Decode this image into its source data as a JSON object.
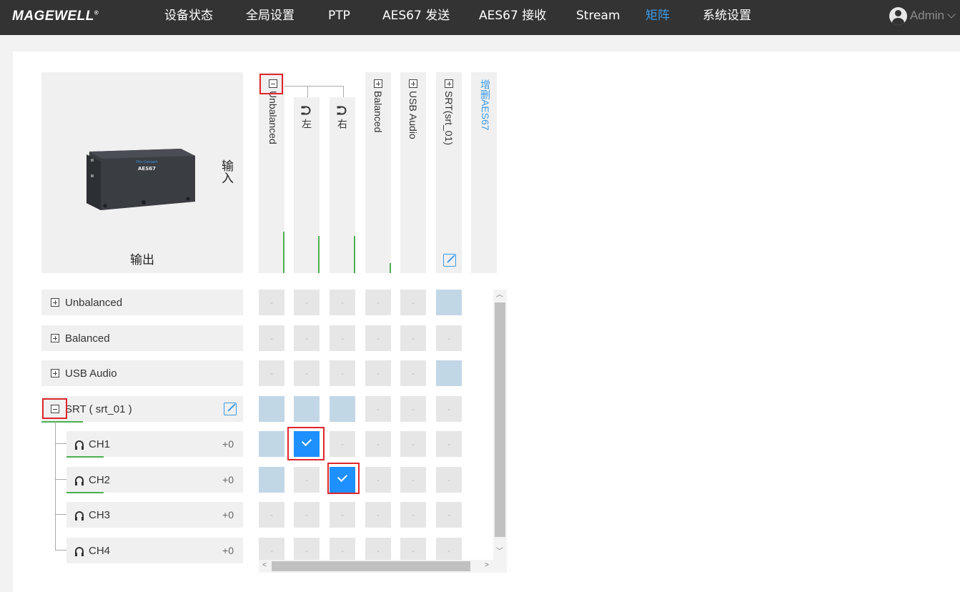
{
  "brand": {
    "logo": "MAGEWELL"
  },
  "nav": {
    "items": [
      {
        "label": "设备状态"
      },
      {
        "label": "全局设置"
      },
      {
        "label": "PTP"
      },
      {
        "label": "AES67 发送"
      },
      {
        "label": "AES67 接收"
      },
      {
        "label": "Stream"
      },
      {
        "label": "矩阵"
      },
      {
        "label": "系统设置"
      }
    ],
    "active": "矩阵",
    "user": "Admin"
  },
  "corner": {
    "output_label": "输出",
    "input_label": "输入",
    "device_model": "AES67",
    "device_name": "Pro Convert"
  },
  "columns": [
    {
      "label": "Unbalanced",
      "expanded": true
    },
    {
      "label": "左",
      "child": true
    },
    {
      "label": "右",
      "child": true
    },
    {
      "label": "Balanced",
      "expanded": false
    },
    {
      "label": "USB Audio",
      "expanded": false
    },
    {
      "label": "SRT(srt_01)",
      "expanded": false
    }
  ],
  "add_aes67": "增删AES67",
  "rows": [
    {
      "label": "Unbalanced",
      "expanded": false
    },
    {
      "label": "Balanced",
      "expanded": false
    },
    {
      "label": "USB Audio",
      "expanded": false
    },
    {
      "label": "SRT ( srt_01 )",
      "expanded": true
    }
  ],
  "channels": [
    {
      "label": "CH1",
      "gain": "+0"
    },
    {
      "label": "CH2",
      "gain": "+0"
    },
    {
      "label": "CH3",
      "gain": "+0"
    },
    {
      "label": "CH4",
      "gain": "+0"
    }
  ],
  "grid": {
    "empty_mark": "-",
    "cells": [
      [
        "-",
        "-",
        "-",
        "-",
        "-",
        "sel"
      ],
      [
        "-",
        "-",
        "-",
        "-",
        "-",
        "-"
      ],
      [
        "-",
        "-",
        "-",
        "-",
        "-",
        "sel"
      ],
      [
        "sel",
        "sel",
        "sel",
        "-",
        "-",
        "-"
      ],
      [
        "sel",
        "on",
        "-",
        "-",
        "-",
        "-"
      ],
      [
        "sel",
        "-",
        "on",
        "-",
        "-",
        "-"
      ],
      [
        "-",
        "-",
        "-",
        "-",
        "-",
        "-"
      ],
      [
        "-",
        "-",
        "-",
        "-",
        "-",
        "-"
      ]
    ]
  },
  "colors": {
    "accent": "#3c9be8",
    "selected": "#1e90ff",
    "level": "#4caf50",
    "highlight": "#e0262b"
  }
}
